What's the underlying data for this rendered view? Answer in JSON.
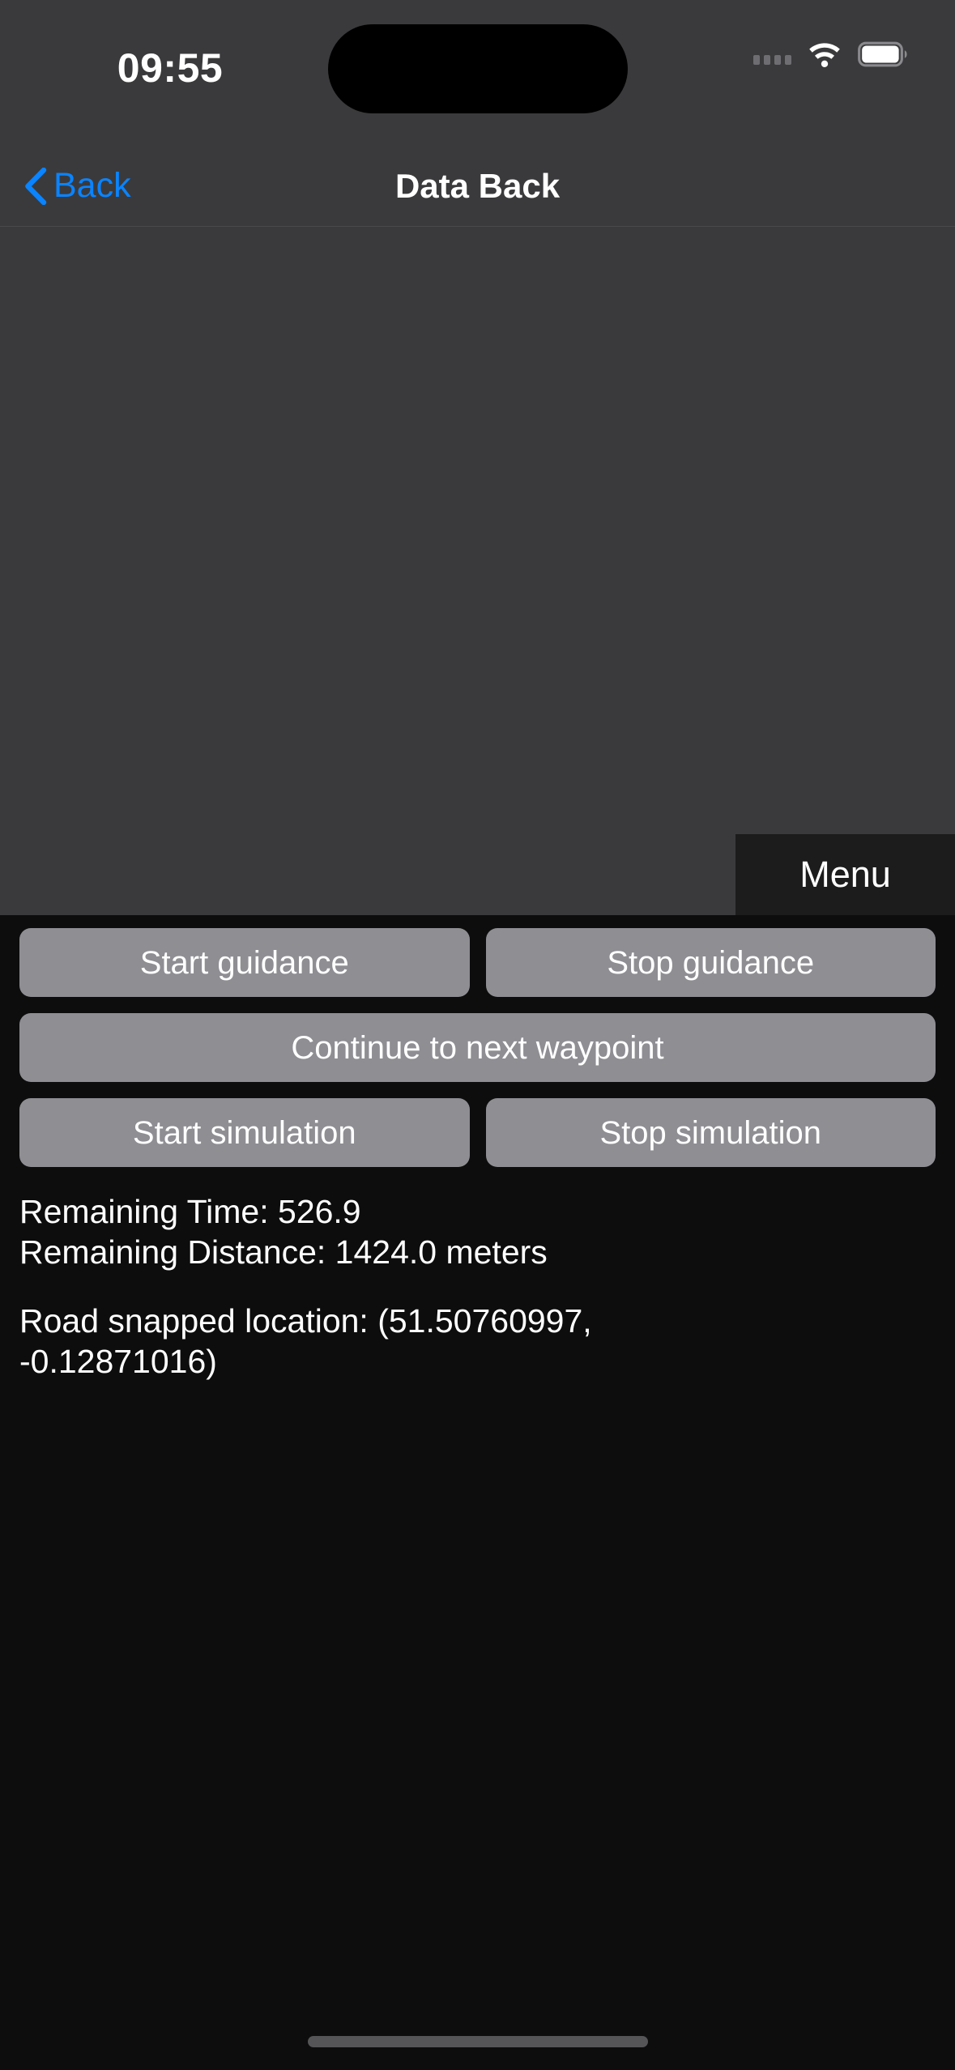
{
  "status_bar": {
    "time": "09:55",
    "icons": {
      "signal": "cellular-signal-icon",
      "wifi": "wifi-icon",
      "battery": "battery-icon"
    }
  },
  "nav_bar": {
    "back_label": "Back",
    "back_icon": "chevron-left-icon",
    "title": "Data Back"
  },
  "map": {
    "menu_label": "Menu"
  },
  "controls": {
    "start_guidance": "Start guidance",
    "stop_guidance": "Stop guidance",
    "continue_waypoint": "Continue to next waypoint",
    "start_simulation": "Start simulation",
    "stop_simulation": "Stop simulation"
  },
  "status": {
    "remaining_time": "Remaining Time: 526.9",
    "remaining_distance": "Remaining Distance: 1424.0 meters",
    "road_snapped_location": "Road snapped location: (51.50760997, -0.12871016)"
  },
  "colors": {
    "accent_blue": "#0a84ff",
    "map_background": "#3a3a3c",
    "panel_background": "#0d0d0d",
    "button_gray": "#8e8e93",
    "menu_background": "#1c1c1c"
  }
}
